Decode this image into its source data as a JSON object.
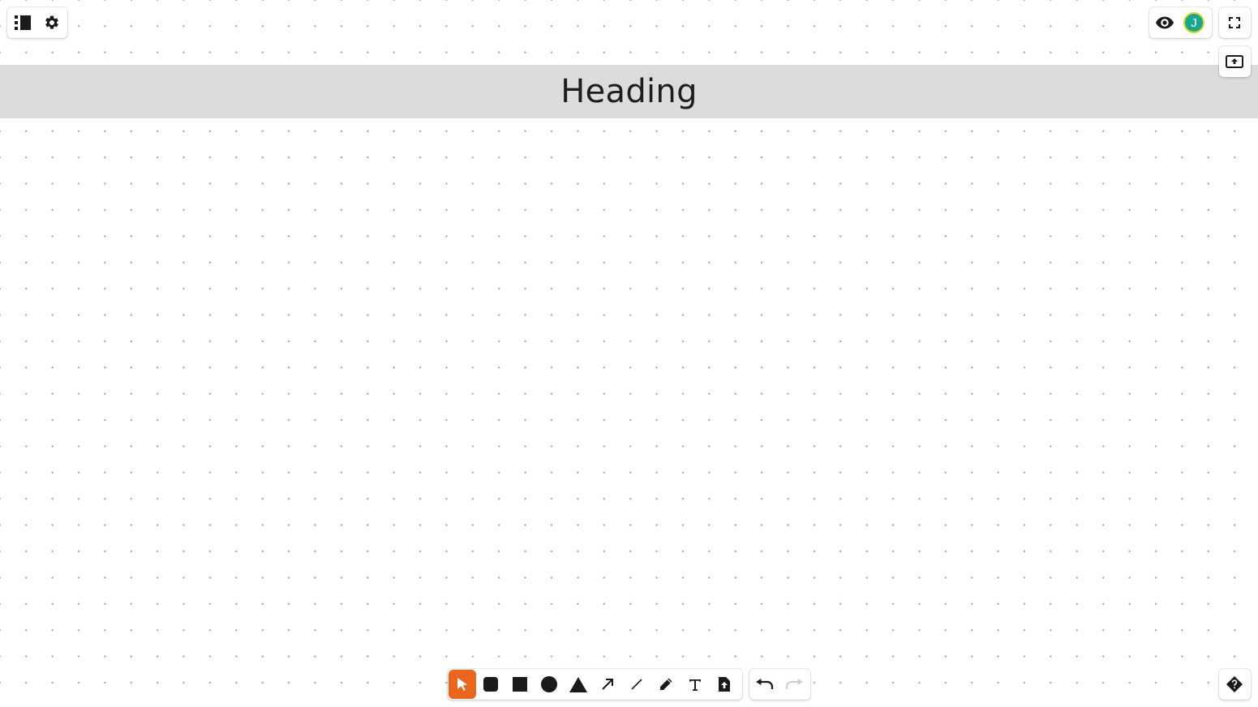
{
  "canvas": {
    "heading_text": "Heading"
  },
  "top_left_menu": {
    "items": [
      {
        "icon": "pages-list-icon"
      },
      {
        "icon": "gear-icon"
      }
    ]
  },
  "top_right": {
    "user_avatar_initial": "J",
    "avatar_color": "#1aa68f",
    "avatar_ring_color": "#d8d82a",
    "icons": [
      "eye-icon",
      "fullscreen-icon",
      "upload-icon"
    ]
  },
  "toolbar": {
    "accent_color": "#e8661d",
    "active_tool": "select",
    "tools": [
      {
        "id": "select",
        "icon": "cursor-icon"
      },
      {
        "id": "rounded-rectangle",
        "icon": "rounded-square-icon"
      },
      {
        "id": "rectangle",
        "icon": "square-icon"
      },
      {
        "id": "ellipse",
        "icon": "circle-icon"
      },
      {
        "id": "triangle",
        "icon": "triangle-icon"
      },
      {
        "id": "arrow",
        "icon": "arrow-icon"
      },
      {
        "id": "line",
        "icon": "line-icon"
      },
      {
        "id": "draw",
        "icon": "pencil-icon"
      },
      {
        "id": "text",
        "icon": "text-icon"
      },
      {
        "id": "asset",
        "icon": "file-upload-icon"
      }
    ],
    "history": [
      {
        "id": "undo",
        "icon": "undo-icon",
        "enabled": true
      },
      {
        "id": "redo",
        "icon": "redo-icon",
        "enabled": false
      }
    ]
  },
  "help": {
    "icon": "help-icon"
  }
}
